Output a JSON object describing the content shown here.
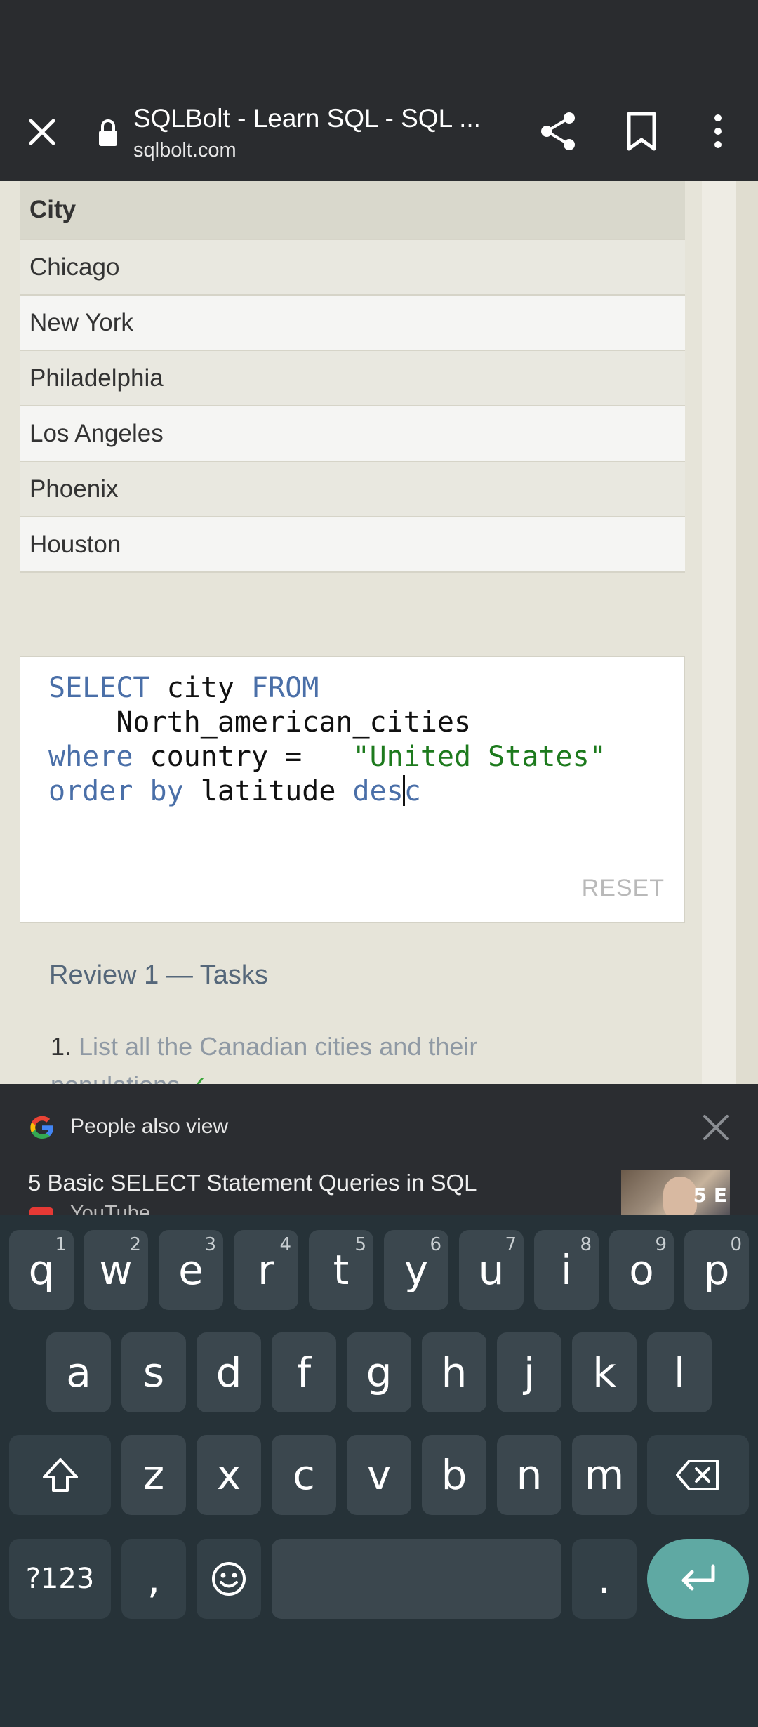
{
  "browser": {
    "title": "SQLBolt - Learn SQL - SQL ...",
    "url": "sqlbolt.com"
  },
  "results": {
    "header": "City",
    "rows": [
      "Chicago",
      "New York",
      "Philadelphia",
      "Los Angeles",
      "Phoenix",
      "Houston"
    ]
  },
  "editor": {
    "line1_kw1": "SELECT",
    "line1_txt": " city ",
    "line1_kw2": "FROM",
    "line2_txt": "    North_american_cities",
    "line3_kw": "where",
    "line3_txt": " country =   ",
    "line3_str": "\"United States\"",
    "line4_kw1": "order by",
    "line4_txt": " latitude ",
    "line4_kw2a": "des",
    "line4_kw2b": "c",
    "reset_label": "RESET"
  },
  "review": {
    "title": "Review 1 — Tasks",
    "task1_num": "1.",
    "task1_text": "List all the Canadian cities and their populations",
    "task1_check": "✓"
  },
  "suggestions": {
    "label": "People also view",
    "item_title": "5 Basic SELECT Statement Queries in SQL",
    "item_source": "YouTube",
    "thumb_text": "5 E"
  },
  "keyboard": {
    "row1": [
      {
        "k": "q",
        "h": "1"
      },
      {
        "k": "w",
        "h": "2"
      },
      {
        "k": "e",
        "h": "3"
      },
      {
        "k": "r",
        "h": "4"
      },
      {
        "k": "t",
        "h": "5"
      },
      {
        "k": "y",
        "h": "6"
      },
      {
        "k": "u",
        "h": "7"
      },
      {
        "k": "i",
        "h": "8"
      },
      {
        "k": "o",
        "h": "9"
      },
      {
        "k": "p",
        "h": "0"
      }
    ],
    "row2": [
      "a",
      "s",
      "d",
      "f",
      "g",
      "h",
      "j",
      "k",
      "l"
    ],
    "row3": [
      "z",
      "x",
      "c",
      "v",
      "b",
      "n",
      "m"
    ],
    "sym_label": "?123",
    "comma": ",",
    "period": "."
  }
}
